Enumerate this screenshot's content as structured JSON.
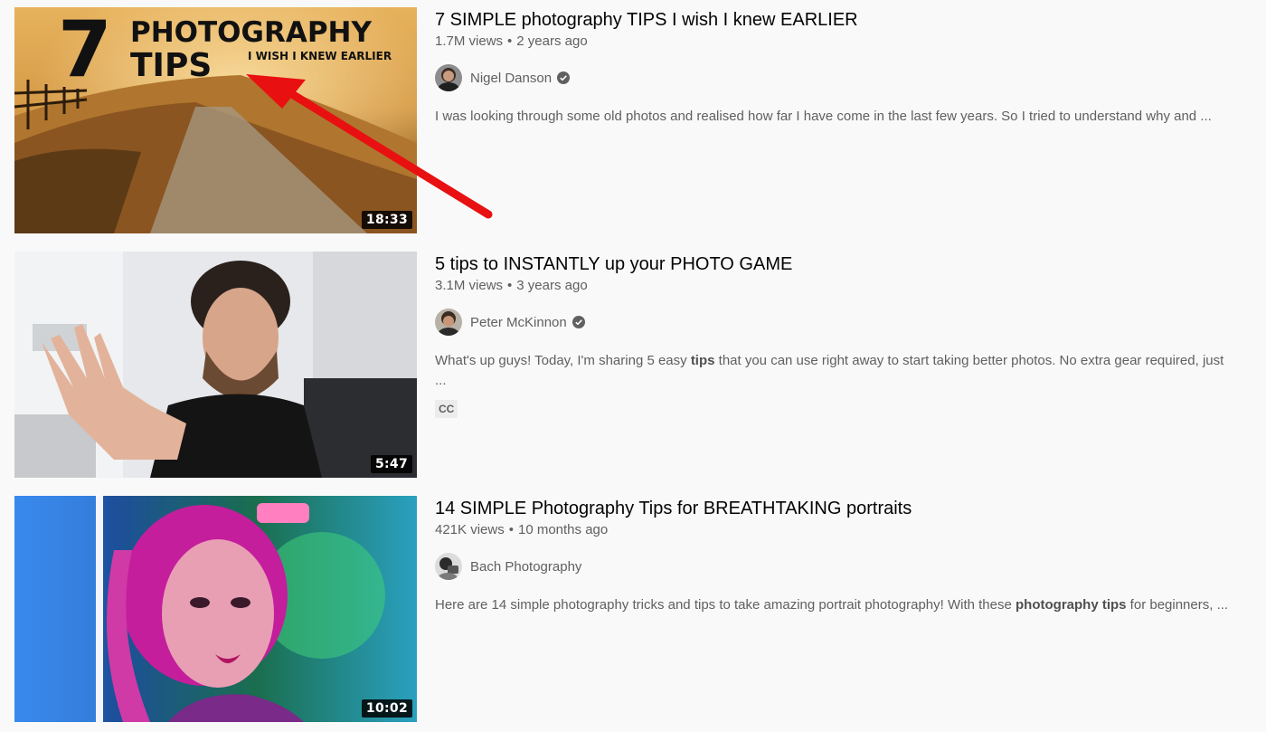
{
  "videos": [
    {
      "title": "7 SIMPLE photography TIPS I wish I knew EARLIER",
      "views": "1.7M views",
      "age": "2 years ago",
      "channel": "Nigel Danson",
      "verified": true,
      "description": "I was looking through some old photos and realised how far I have come in the last few years. So I tried to understand why and ...",
      "duration": "18:33",
      "thumb_text": {
        "big": "7",
        "line1": "PHOTOGRAPHY",
        "line2": "TIPS",
        "line3": "I WISH I KNEW EARLIER"
      }
    },
    {
      "title": "5 tips to INSTANTLY up your PHOTO GAME",
      "views": "3.1M views",
      "age": "3 years ago",
      "channel": "Peter McKinnon",
      "verified": true,
      "description_before": "What's up guys! Today, I'm sharing 5 easy ",
      "description_bold": "tips",
      "description_after": " that you can use right away to start taking better photos. No extra gear required, just ...",
      "badge": "CC",
      "duration": "5:47"
    },
    {
      "title": "14 SIMPLE Photography Tips for BREATHTAKING portraits",
      "views": "421K views",
      "age": "10 months ago",
      "channel": "Bach Photography",
      "verified": false,
      "description_before": "Here are 14 simple photography tricks and tips to take amazing portrait photography! With these ",
      "description_bold": "photography tips",
      "description_after": " for beginners, ...",
      "duration": "10:02"
    }
  ],
  "meta_separator": "•",
  "colors": {
    "background": "#f9f9f9",
    "title": "#030303",
    "meta": "#606060",
    "annotation_arrow": "#e81010"
  }
}
